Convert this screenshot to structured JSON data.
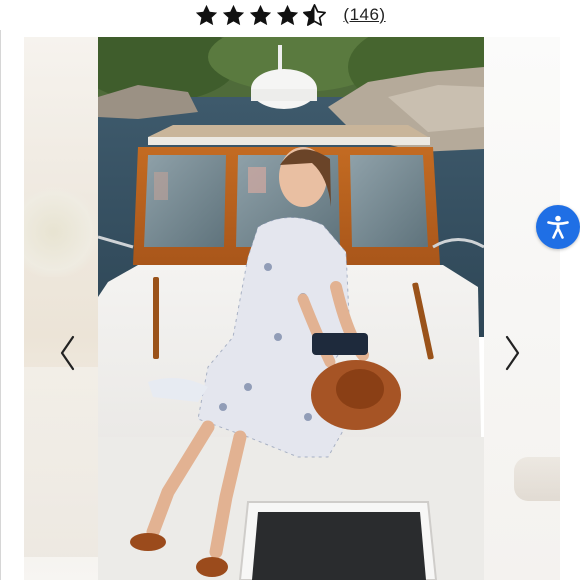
{
  "rating": {
    "stars": 4.5,
    "max_stars": 5,
    "review_count": "(146)"
  },
  "carousel": {
    "prev_icon": "chevron-left-icon",
    "next_icon": "chevron-right-icon"
  },
  "accessibility": {
    "icon": "accessibility-person-icon",
    "color": "#1f6fe5"
  },
  "colors": {
    "star": "#111111",
    "accent": "#1f6fe5"
  }
}
